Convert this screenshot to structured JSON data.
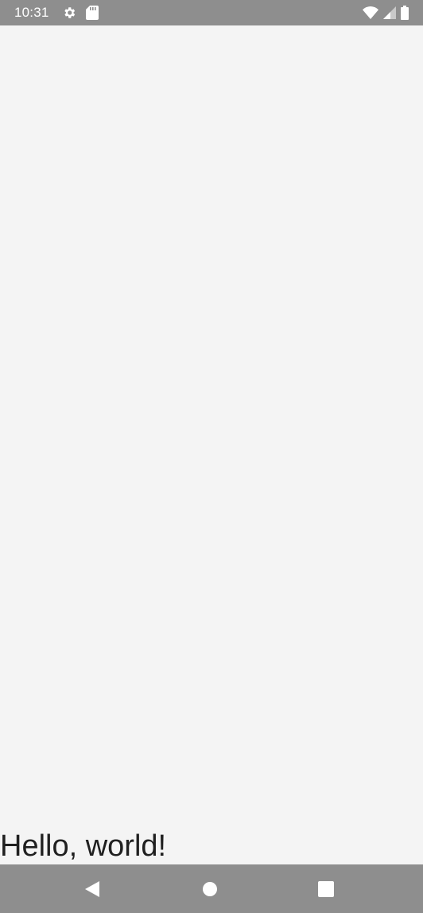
{
  "status_bar": {
    "time": "10:31",
    "left_icons": [
      "gear-icon",
      "sd-card-icon"
    ],
    "right_icons": [
      "wifi-icon",
      "cell-signal-icon",
      "battery-icon"
    ],
    "background": "#8e8e8e"
  },
  "main": {
    "text": "Hello, world!",
    "background": "#f4f4f4"
  },
  "nav_bar": {
    "buttons": [
      "back-icon",
      "home-icon",
      "recents-icon"
    ],
    "background": "#8e8e8e"
  }
}
